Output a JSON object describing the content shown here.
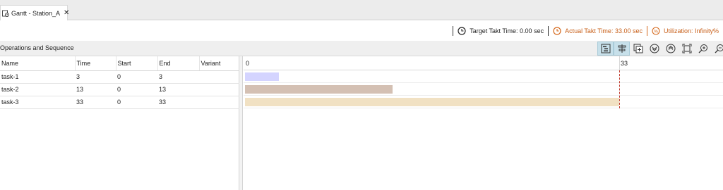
{
  "tab": {
    "label": "Gantt - Station_A",
    "close": "✕"
  },
  "status": {
    "target_takt": "Target Takt Time: 0.00 sec",
    "actual_takt": "Actual Takt Time: 33.00 sec",
    "utilization": "Utilization: Infinity%"
  },
  "section": {
    "title": "Operations and Sequence"
  },
  "toolbar": {
    "buttons": [
      "gantt-view-icon",
      "align-icon",
      "add-box-icon",
      "collapse-down-icon",
      "collapse-up-icon",
      "fit-icon",
      "zoom-in-icon",
      "zoom-out-icon"
    ]
  },
  "table": {
    "headers": [
      "Name",
      "Time",
      "Start",
      "End",
      "Variant"
    ],
    "rows": [
      {
        "name": "task-1",
        "time": "3",
        "start": "0",
        "end": "3",
        "variant": ""
      },
      {
        "name": "task-2",
        "time": "13",
        "start": "0",
        "end": "13",
        "variant": ""
      },
      {
        "name": "task-3",
        "time": "33",
        "start": "0",
        "end": "33",
        "variant": ""
      }
    ]
  },
  "gantt": {
    "tick_labels": [
      "0",
      "33"
    ],
    "takt_value": 33,
    "max": 33,
    "bars": [
      {
        "start": 0,
        "end": 3,
        "color": "#d4d4ff"
      },
      {
        "start": 0,
        "end": 13,
        "color": "#d4c0b3"
      },
      {
        "start": 0,
        "end": 33,
        "color": "#f1e1c3"
      }
    ]
  },
  "colors": {
    "accent_orange": "#c8601a",
    "takt_line": "#c0392b",
    "toolbar_active": "#c7e0ea"
  }
}
